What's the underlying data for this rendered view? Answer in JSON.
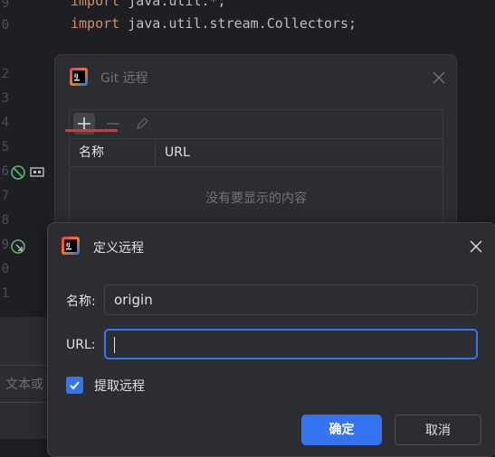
{
  "editor": {
    "line_numbers": [
      "9",
      "0",
      "2",
      "3",
      "4",
      "5",
      "6",
      "7",
      "8",
      "9",
      "0",
      "1"
    ],
    "code_lines": [
      {
        "keyword": "import",
        "rest": " java.util.*;"
      },
      {
        "keyword": "import",
        "rest": " java.util.stream.Collectors;"
      }
    ],
    "search_placeholder": "文本或"
  },
  "git_remotes_dialog": {
    "title": "Git 远程",
    "columns": [
      "名称",
      "URL"
    ],
    "empty_text": "没有要显示的内容"
  },
  "define_remote_dialog": {
    "title": "定义远程",
    "name_label": "名称:",
    "name_value": "origin",
    "url_label": "URL:",
    "url_value": "",
    "fetch_label": "提取远程",
    "fetch_checked": true,
    "ok_label": "确定",
    "cancel_label": "取消"
  },
  "colors": {
    "accent": "#3574f0",
    "highlight_underline": "#e5322d"
  }
}
